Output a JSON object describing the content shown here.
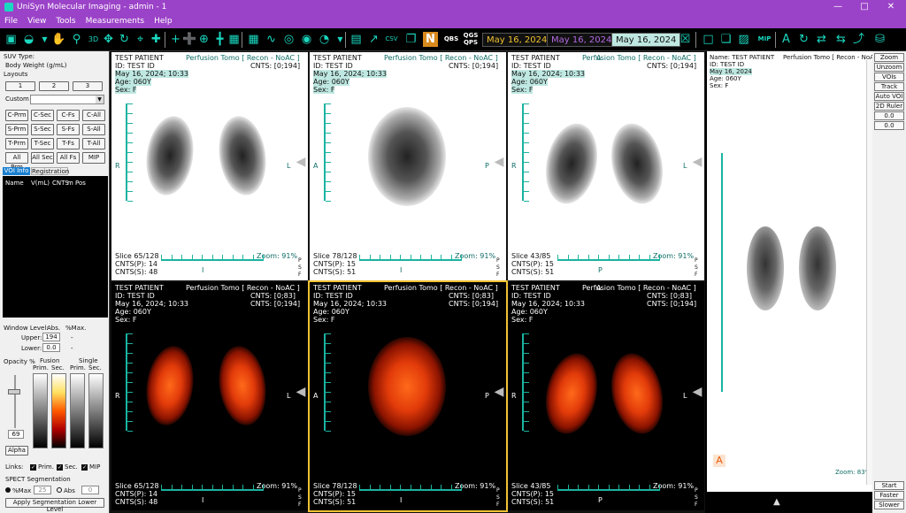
{
  "window": {
    "title": "UniSyn Molecular Imaging - admin - 1"
  },
  "menu": [
    "File",
    "View",
    "Tools",
    "Measurements",
    "Help"
  ],
  "toolbar": {
    "dates": [
      "May 16, 2024",
      "May 16, 2024",
      "May 16, 2024"
    ],
    "qgs": "QGS",
    "qps": "QPS",
    "qbs": "QBS",
    "mip": "MIP"
  },
  "left": {
    "suv_type": "SUV Type:",
    "suv_value": "Body Weight (g/mL)",
    "layouts": "Layouts",
    "layout_buttons": [
      "1",
      "2",
      "3"
    ],
    "custom": "Custom",
    "grid_buttons": [
      "C-Prm",
      "C-Sec",
      "C-Fs",
      "C-All",
      "S-Prm",
      "S-Sec",
      "S-Fs",
      "S-All",
      "T-Prm",
      "T-Sec",
      "T-Fs",
      "T-All",
      "All Prm",
      "All Sec",
      "All Fs",
      "MIP"
    ],
    "tabs": [
      "VOI Info",
      "Registration"
    ],
    "voi_headers": [
      "Name",
      "V(mL)",
      "CNTS",
      "m",
      "Pos"
    ],
    "window_level": "Window Level:",
    "abs": "Abs.",
    "pct_max": "%Max.",
    "upper_label": "Upper:",
    "upper_value": "194",
    "lower_label": "Lower:",
    "lower_value": "0.0",
    "dash1": "-",
    "dash2": "-",
    "opacity": "Opacity %",
    "fusion": "Fusion",
    "single": "Single",
    "prim": "Prim.",
    "sec": "Sec.",
    "opacity_value": "69",
    "alpha": "Alpha",
    "links": "Links:",
    "link_prim": "Prim.",
    "link_sec": "Sec.",
    "link_mip": "MIP",
    "spect_seg": "SPECT Segmentation",
    "seg_pct": "%Max",
    "seg_pct_value": "25",
    "seg_abs": "Abs",
    "seg_abs_value": "0",
    "apply": "Apply Segmentation Lower Level"
  },
  "viewports": [
    {
      "patient": "TEST PATIENT",
      "id": "ID: TEST ID",
      "date": "May 16, 2024; 10:33",
      "age": "Age: 060Y",
      "sex": "Sex: F",
      "series": "Perfusion Tomo [ Recon - NoAC ]",
      "cnts_top": "CNTS: [0;194]",
      "cnts_top2": "",
      "slice": "Slice 65/128",
      "cntsp": "CNTS(P): 14",
      "cntss": "CNTS(S): 48",
      "zoom": "Zoom: 91%",
      "left_dir": "R",
      "right_dir": "L",
      "top_dir": "",
      "bottom_dir": "I",
      "psf": [
        "P",
        "S",
        "F"
      ]
    },
    {
      "patient": "TEST PATIENT",
      "id": "ID: TEST ID",
      "date": "May 16, 2024; 10:33",
      "age": "Age: 060Y",
      "sex": "Sex: F",
      "series": "Perfusion Tomo [ Recon - NoAC ]",
      "cnts_top": "CNTS: [0;194]",
      "cnts_top2": "",
      "slice": "Slice 78/128",
      "cntsp": "CNTS(P): 15",
      "cntss": "CNTS(S): 51",
      "zoom": "Zoom: 91%",
      "left_dir": "A",
      "right_dir": "P",
      "top_dir": "",
      "bottom_dir": "I",
      "psf": [
        "P",
        "S",
        "F"
      ]
    },
    {
      "patient": "TEST PATIENT",
      "id": "ID: TEST ID",
      "date": "May 16, 2024; 10:33",
      "age": "Age: 060Y",
      "sex": "Sex: F",
      "series": "Perfusion Tomo [ Recon - NoAC ]",
      "cnts_top": "CNTS: [0;194]",
      "cnts_top2": "",
      "slice": "Slice 43/85",
      "cntsp": "CNTS(P): 15",
      "cntss": "CNTS(S): 51",
      "zoom": "Zoom: 91%",
      "left_dir": "R",
      "right_dir": "L",
      "top_dir": "A",
      "bottom_dir": "P",
      "psf": [
        "P",
        "S",
        "F"
      ]
    },
    {
      "patient": "TEST PATIENT",
      "id": "ID: TEST ID",
      "date": "May 16, 2024; 10:33",
      "age": "Age: 060Y",
      "sex": "Sex: F",
      "series": "Perfusion Tomo [ Recon - NoAC ]",
      "cnts_top": "CNTS: [0;83]",
      "cnts_top2": "CNTS: [0;194]",
      "slice": "Slice 65/128",
      "cntsp": "CNTS(P): 14",
      "cntss": "CNTS(S): 48",
      "zoom": "Zoom: 91%",
      "left_dir": "R",
      "right_dir": "L",
      "top_dir": "",
      "bottom_dir": "I",
      "psf": [
        "P",
        "S",
        "F"
      ]
    },
    {
      "patient": "TEST PATIENT",
      "id": "ID: TEST ID",
      "date": "May 16, 2024; 10:33",
      "age": "Age: 060Y",
      "sex": "Sex: F",
      "series": "Perfusion Tomo [ Recon - NoAC ]",
      "cnts_top": "CNTS: [0;83]",
      "cnts_top2": "CNTS: [0;194]",
      "slice": "Slice 78/128",
      "cntsp": "CNTS(P): 15",
      "cntss": "CNTS(S): 51",
      "zoom": "Zoom: 91%",
      "left_dir": "A",
      "right_dir": "P",
      "top_dir": "",
      "bottom_dir": "I",
      "psf": [
        "P",
        "S",
        "F"
      ]
    },
    {
      "patient": "TEST PATIENT",
      "id": "ID: TEST ID",
      "date": "May 16, 2024; 10:33",
      "age": "Age: 060Y",
      "sex": "Sex: F",
      "series": "Perfusion Tomo [ Recon - NoAC ]",
      "cnts_top": "CNTS: [0;83]",
      "cnts_top2": "CNTS: [0;194]",
      "slice": "Slice 43/85",
      "cntsp": "CNTS(P): 15",
      "cntss": "CNTS(S): 51",
      "zoom": "Zoom: 91%",
      "left_dir": "R",
      "right_dir": "L",
      "top_dir": "A",
      "bottom_dir": "P",
      "psf": [
        "P",
        "S",
        "F"
      ]
    }
  ],
  "mip_panel": {
    "name": "Name: TEST PATIENT",
    "series": "Perfusion Tomo [ Recon - NoAC ]",
    "id": "ID: TEST ID",
    "date": "May 16, 2024",
    "age": "Age: 060Y",
    "sex": "Sex: F",
    "zoom": "Zoom: 83%",
    "a_label": "A"
  },
  "right_buttons": [
    "Zoom",
    "Unzoom",
    "VOIs",
    "Track",
    "Auto VOI",
    "2D Ruler",
    "0.0",
    "0.0"
  ],
  "cine_buttons": [
    "Start",
    "Faster",
    "Slower"
  ]
}
